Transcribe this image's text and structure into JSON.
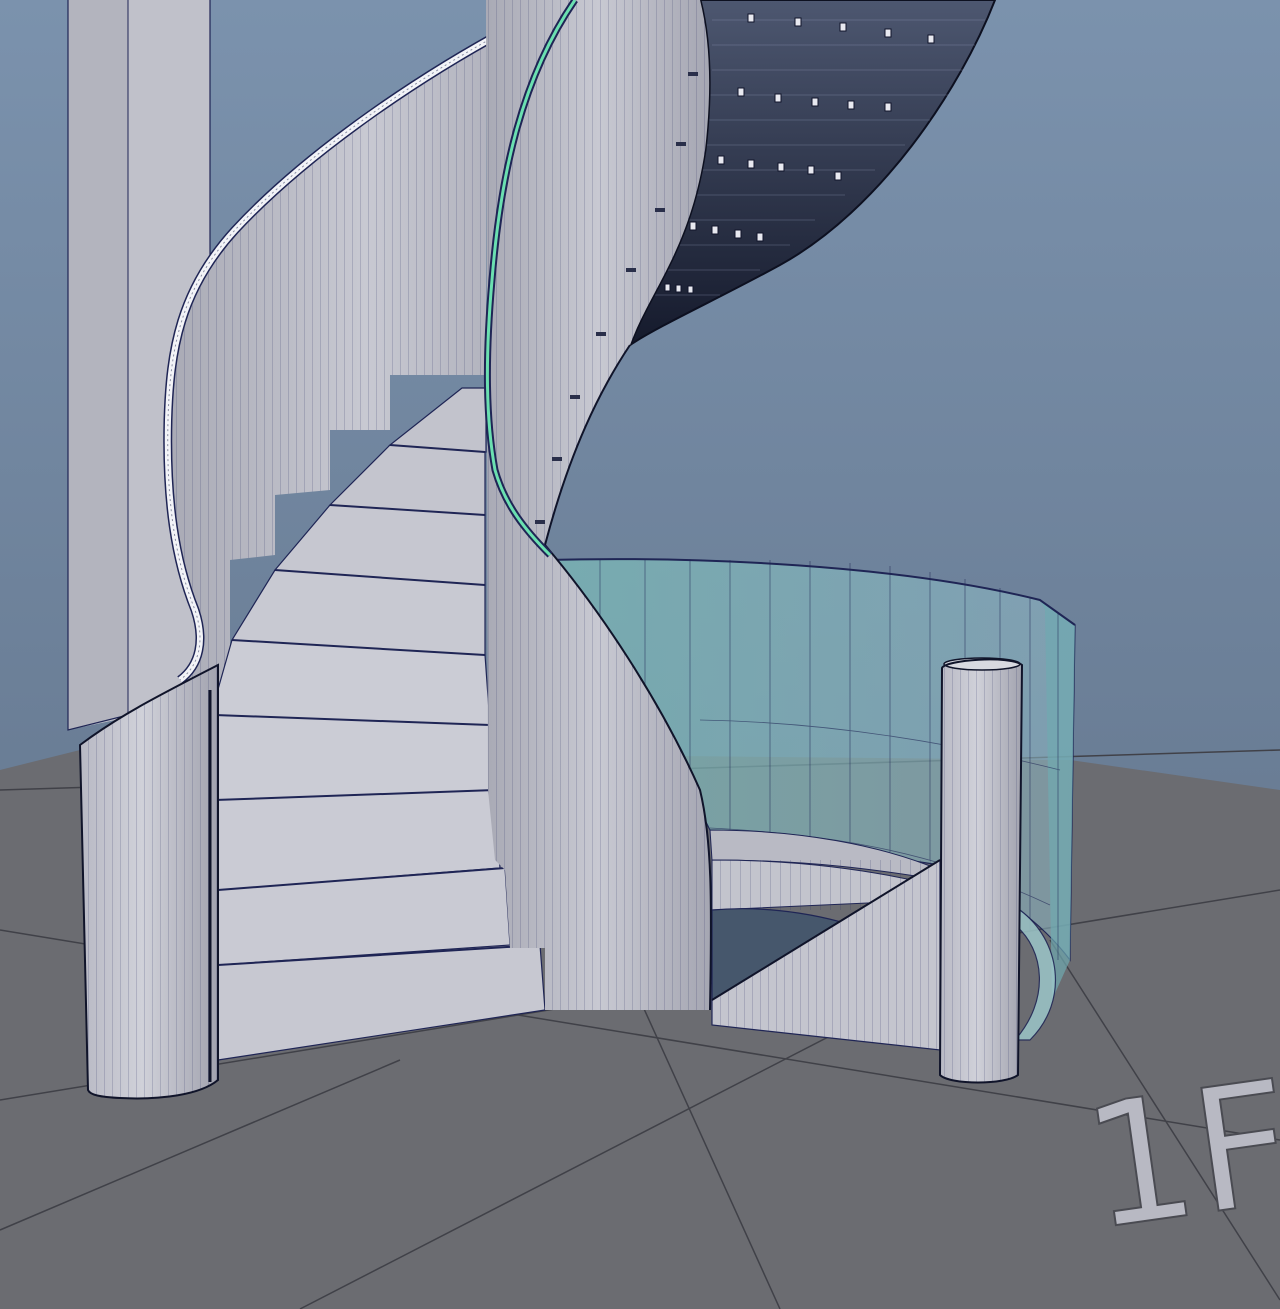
{
  "viewport": {
    "floor_label": "1F",
    "colors": {
      "sky_top": "#7a90ac",
      "sky_bottom": "#5f7187",
      "floor": "#6b6c70",
      "floor_grid": "#3f4045",
      "geometry": "#c5c6cf",
      "geometry_shade": "#9a9ba6",
      "wire": "#1f2555",
      "glass": "#7fc4c0",
      "highlight_edge": "#66ddaa"
    },
    "objects": [
      "back-column",
      "spiral-staircase",
      "outer-stringer-wall",
      "inner-stringer-wall",
      "upper-stair-flight",
      "glass-railing",
      "newel-post-left",
      "newel-post-right",
      "stairwell-opening"
    ]
  }
}
